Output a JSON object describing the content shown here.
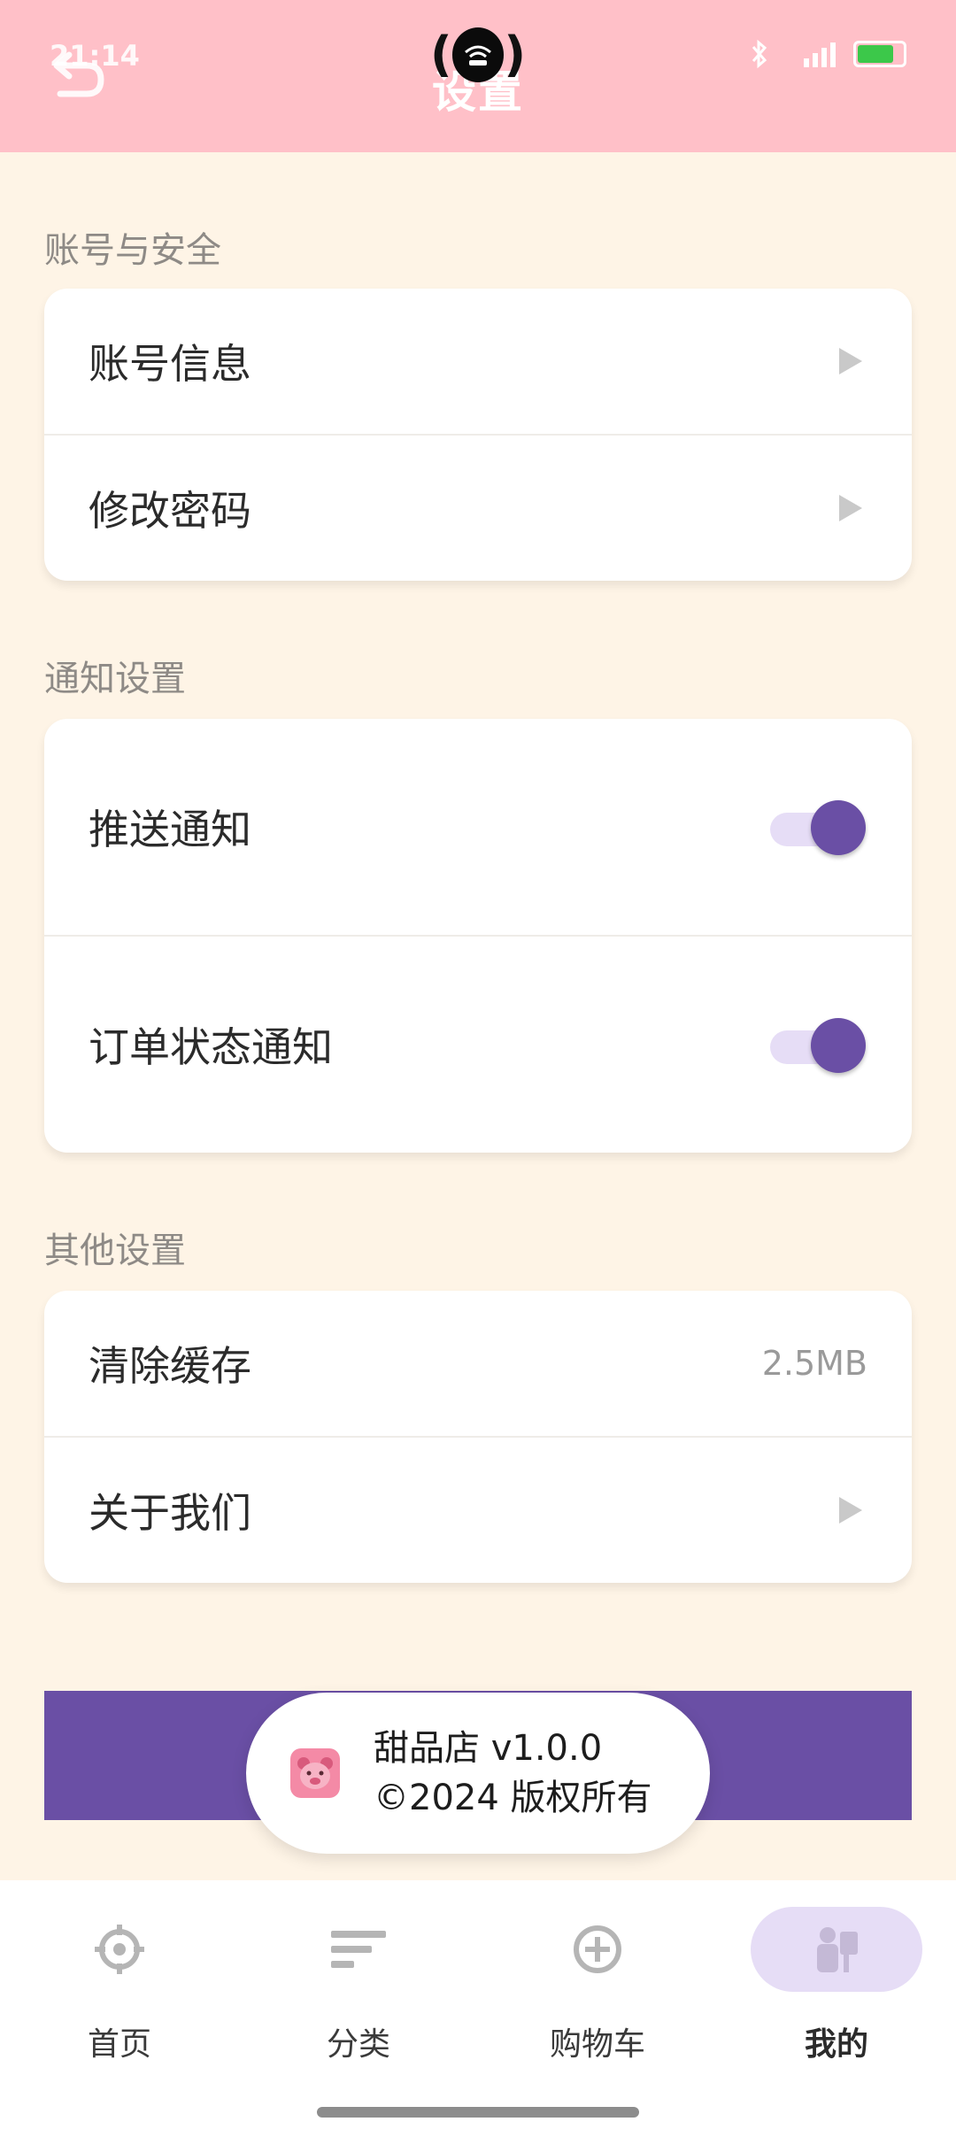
{
  "status_bar": {
    "time": "21:14"
  },
  "header": {
    "title": "设置"
  },
  "sections": [
    {
      "title": "账号与安全",
      "items": [
        {
          "label": "账号信息"
        },
        {
          "label": "修改密码"
        }
      ]
    },
    {
      "title": "通知设置",
      "items": [
        {
          "label": "推送通知",
          "enabled": true
        },
        {
          "label": "订单状态通知",
          "enabled": true
        }
      ]
    },
    {
      "title": "其他设置",
      "items": [
        {
          "label": "清除缓存",
          "value": "2.5MB"
        },
        {
          "label": "关于我们"
        }
      ]
    }
  ],
  "toast": {
    "line1": "甜品店 v1.0.0",
    "line2": "©2024 版权所有"
  },
  "bottom_nav": {
    "items": [
      {
        "label": "首页",
        "icon": "compass-icon"
      },
      {
        "label": "分类",
        "icon": "list-icon"
      },
      {
        "label": "购物车",
        "icon": "add-circle-icon"
      },
      {
        "label": "我的",
        "icon": "profile-icon"
      }
    ]
  },
  "colors": {
    "header_bg": "#FFC0C8",
    "page_bg": "#FEF4E6",
    "accent": "#6A4FA5",
    "toggle_track": "#E6DDF6"
  }
}
